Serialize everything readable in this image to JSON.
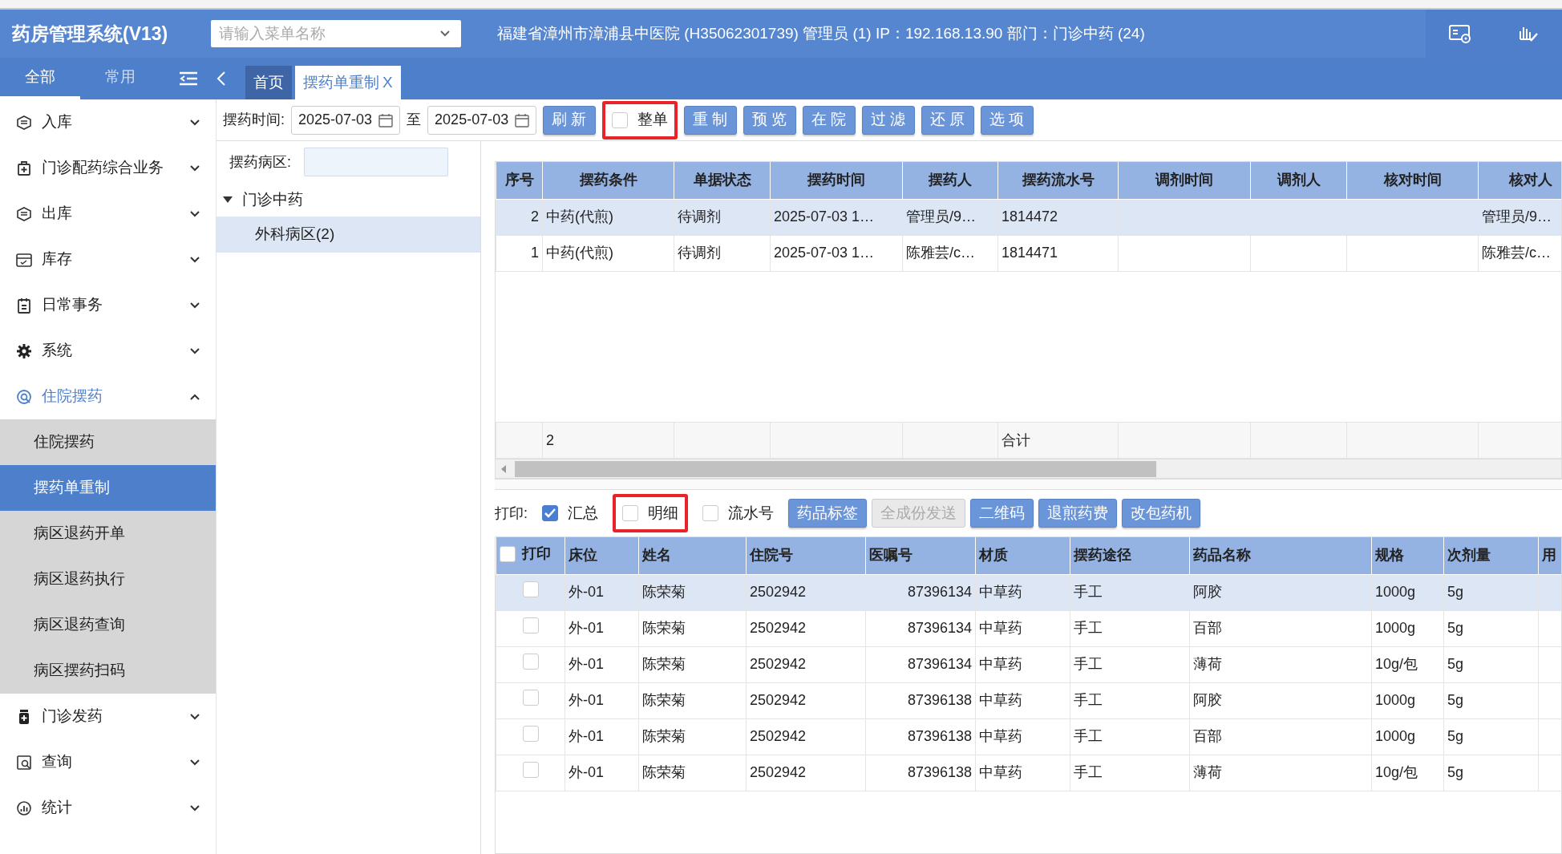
{
  "app_title": "药房管理系统(V13)",
  "menu_search": {
    "placeholder": "请输入菜单名称"
  },
  "header_info": "福建省漳州市漳浦县中医院 (H35062301739) 管理员 (1) IP：192.168.13.90 部门：门诊中药 (24)",
  "sidebar_tabs": [
    {
      "label": "全部",
      "selected": true
    },
    {
      "label": "常用",
      "selected": false
    }
  ],
  "page_tabs": [
    {
      "label": "首页",
      "selected": false
    },
    {
      "label": "摆药单重制",
      "selected": true,
      "close": "X"
    }
  ],
  "sidebar": [
    {
      "label": "入库",
      "expanded": false
    },
    {
      "label": "门诊配药综合业务",
      "expanded": false
    },
    {
      "label": "出库",
      "expanded": false
    },
    {
      "label": "库存",
      "expanded": false
    },
    {
      "label": "日常事务",
      "expanded": false
    },
    {
      "label": "系统",
      "expanded": false
    },
    {
      "label": "住院摆药",
      "expanded": true,
      "children": [
        {
          "label": "住院摆药",
          "selected": false
        },
        {
          "label": "摆药单重制",
          "selected": true
        },
        {
          "label": "病区退药开单",
          "selected": false
        },
        {
          "label": "病区退药执行",
          "selected": false
        },
        {
          "label": "病区退药查询",
          "selected": false
        },
        {
          "label": "病区摆药扫码",
          "selected": false
        }
      ]
    },
    {
      "label": "门诊发药",
      "expanded": false
    },
    {
      "label": "查询",
      "expanded": false
    },
    {
      "label": "统计",
      "expanded": false
    }
  ],
  "toolbar": {
    "date_label": "摆药时间:",
    "date_from": "2025-07-03",
    "between": "至",
    "date_to": "2025-07-03",
    "controls": [
      {
        "kind": "button",
        "label": "刷新"
      },
      {
        "kind": "checkbox",
        "label": "整单",
        "checked": false,
        "highlighted": true
      },
      {
        "kind": "button",
        "label": "重制"
      },
      {
        "kind": "button",
        "label": "预览"
      },
      {
        "kind": "button",
        "label": "在院"
      },
      {
        "kind": "button",
        "label": "过滤"
      },
      {
        "kind": "button",
        "label": "还原"
      },
      {
        "kind": "button",
        "label": "选项"
      }
    ]
  },
  "ward_filter": {
    "label": "摆药病区:"
  },
  "ward_tree": [
    {
      "label": "门诊中药",
      "expanded": true,
      "children": [
        {
          "label": "外科病区(2)",
          "selected": true
        }
      ]
    }
  ],
  "orders_table": {
    "columns": [
      "序号",
      "摆药条件",
      "单据状态",
      "摆药时间",
      "摆药人",
      "摆药流水号",
      "调剂时间",
      "调剂人",
      "核对时间",
      "核对人"
    ],
    "rows": [
      {
        "selected": true,
        "cells": [
          "2",
          "中药(代煎)",
          "待调剂",
          "2025-07-03 1…",
          "管理员/9…",
          "1814472",
          "",
          "",
          "",
          "管理员/9…"
        ]
      },
      {
        "selected": false,
        "cells": [
          "1",
          "中药(代煎)",
          "待调剂",
          "2025-07-03 1…",
          "陈雅芸/c…",
          "1814471",
          "",
          "",
          "",
          "陈雅芸/c…"
        ]
      }
    ],
    "footer": {
      "count": "2",
      "total_label": "合计"
    }
  },
  "print_bar": {
    "label": "打印:",
    "options": [
      {
        "label": "汇总",
        "checked": true,
        "highlighted": false
      },
      {
        "label": "明细",
        "checked": false,
        "highlighted": true
      },
      {
        "label": "流水号",
        "checked": false,
        "highlighted": false
      }
    ],
    "buttons": [
      {
        "label": "药品标签",
        "disabled": false
      },
      {
        "label": "全成份发送",
        "disabled": true
      },
      {
        "label": "二维码",
        "disabled": false
      },
      {
        "label": "退煎药费",
        "disabled": false
      },
      {
        "label": "改包药机",
        "disabled": false
      }
    ]
  },
  "details_table": {
    "header_checked": false,
    "columns": [
      "打印",
      "床位",
      "姓名",
      "住院号",
      "医嘱号",
      "材质",
      "摆药途径",
      "药品名称",
      "规格",
      "次剂量",
      "用"
    ],
    "rows": [
      {
        "selected": true,
        "checked": false,
        "cells": [
          "",
          "外-01",
          "陈荣菊",
          "2502942",
          "87396134",
          "中草药",
          "手工",
          "阿胶",
          "1000g",
          "5g"
        ]
      },
      {
        "selected": false,
        "checked": false,
        "cells": [
          "",
          "外-01",
          "陈荣菊",
          "2502942",
          "87396134",
          "中草药",
          "手工",
          "百部",
          "1000g",
          "5g"
        ]
      },
      {
        "selected": false,
        "checked": false,
        "cells": [
          "",
          "外-01",
          "陈荣菊",
          "2502942",
          "87396134",
          "中草药",
          "手工",
          "薄荷",
          "10g/包",
          "5g"
        ]
      },
      {
        "selected": false,
        "checked": false,
        "cells": [
          "",
          "外-01",
          "陈荣菊",
          "2502942",
          "87396138",
          "中草药",
          "手工",
          "阿胶",
          "1000g",
          "5g"
        ]
      },
      {
        "selected": false,
        "checked": false,
        "cells": [
          "",
          "外-01",
          "陈荣菊",
          "2502942",
          "87396138",
          "中草药",
          "手工",
          "百部",
          "1000g",
          "5g"
        ]
      },
      {
        "selected": false,
        "checked": false,
        "cells": [
          "",
          "外-01",
          "陈荣菊",
          "2502942",
          "87396138",
          "中草药",
          "手工",
          "薄荷",
          "10g/包",
          "5g"
        ]
      }
    ]
  }
}
